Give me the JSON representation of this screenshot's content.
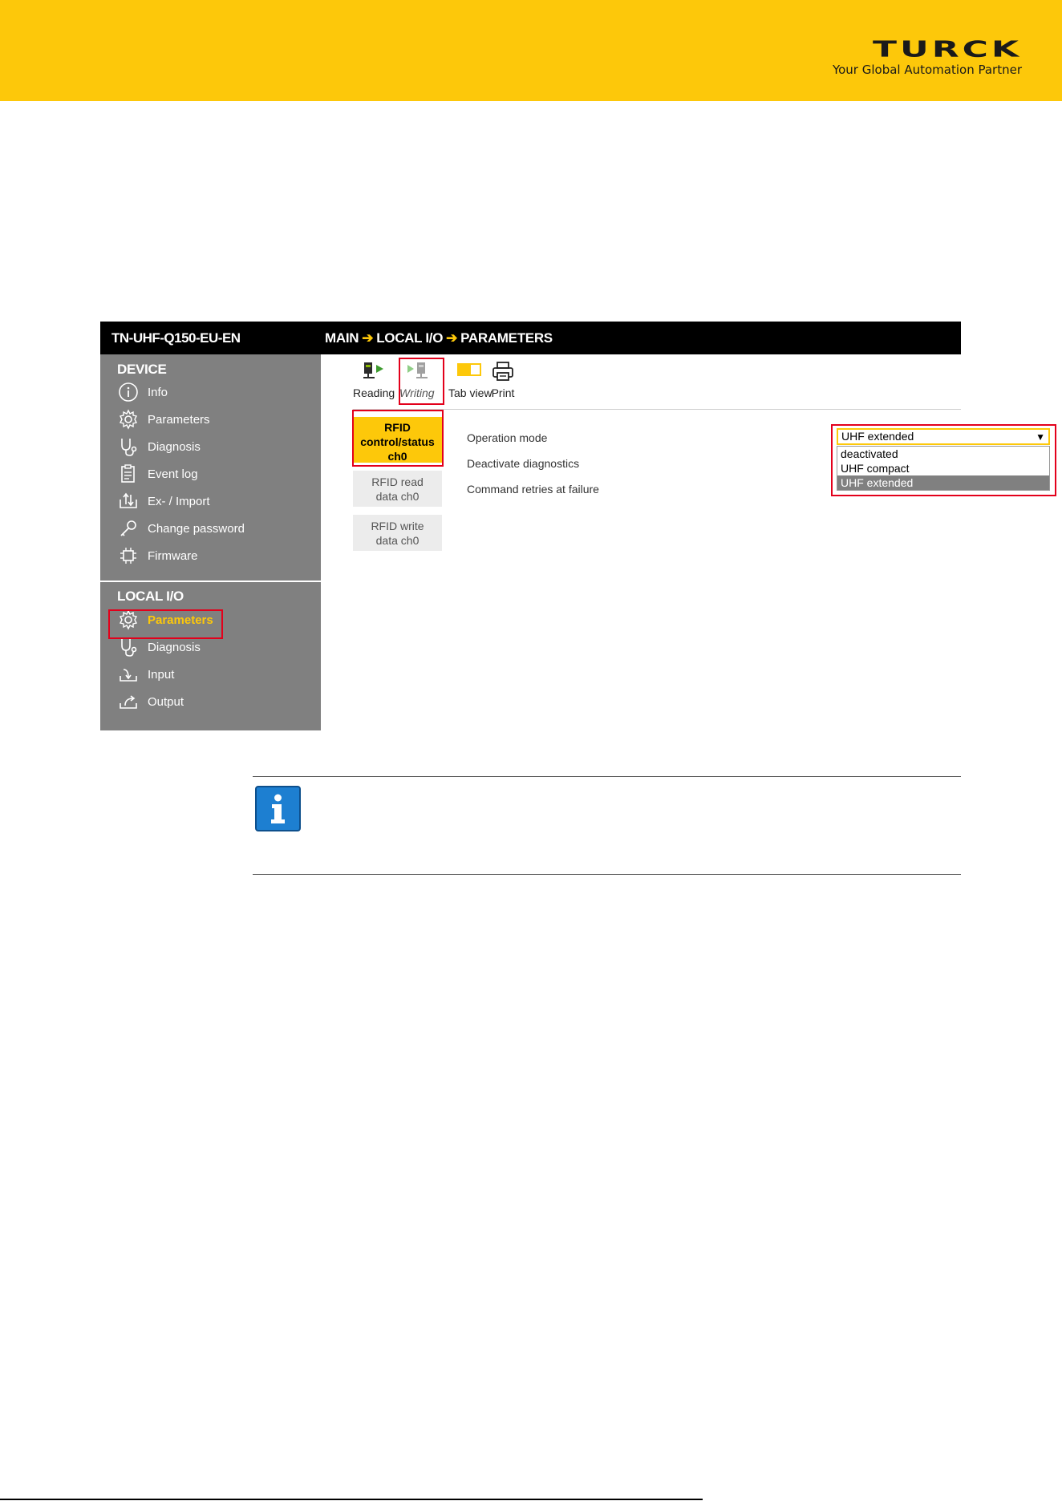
{
  "brand": {
    "logo_text": "TURCK",
    "tagline": "Your Global Automation Partner",
    "color": "#fdc80a"
  },
  "header": {
    "device_name": "TN-UHF-Q150-EU-EN",
    "breadcrumb": [
      "MAIN",
      "LOCAL I/O",
      "PARAMETERS"
    ],
    "arrow": "➔"
  },
  "sidebar": {
    "device_section": {
      "title": "DEVICE",
      "items": [
        {
          "label": "Info",
          "icon": "info-icon"
        },
        {
          "label": "Parameters",
          "icon": "gear-icon"
        },
        {
          "label": "Diagnosis",
          "icon": "stethoscope-icon"
        },
        {
          "label": "Event log",
          "icon": "clipboard-icon"
        },
        {
          "label": "Ex- / Import",
          "icon": "import-export-icon"
        },
        {
          "label": "Change password",
          "icon": "key-icon"
        },
        {
          "label": "Firmware",
          "icon": "chip-icon"
        }
      ]
    },
    "local_io_section": {
      "title": "LOCAL I/O",
      "items": [
        {
          "label": "Parameters",
          "icon": "gear-icon",
          "active": true
        },
        {
          "label": "Diagnosis",
          "icon": "stethoscope-icon"
        },
        {
          "label": "Input",
          "icon": "input-icon"
        },
        {
          "label": "Output",
          "icon": "output-icon"
        }
      ]
    }
  },
  "toolbar": {
    "reading": "Reading",
    "writing": "Writing",
    "tab_view": "Tab view",
    "print": "Print"
  },
  "tabs": [
    {
      "label": "RFID control/status ch0",
      "active": true
    },
    {
      "label": "RFID read data ch0",
      "active": false
    },
    {
      "label": "RFID write data ch0",
      "active": false
    }
  ],
  "params": {
    "operation_mode": "Operation mode",
    "deactivate_diagnostics": "Deactivate diagnostics",
    "command_retries": "Command retries at failure"
  },
  "operation_mode_select": {
    "selected": "UHF extended",
    "options": [
      "deactivated",
      "UHF compact",
      "UHF extended"
    ]
  },
  "colors": {
    "accent": "#fdc80a",
    "highlight": "#e3001b",
    "sidebar": "#808080",
    "info": "#1d7fd1"
  }
}
